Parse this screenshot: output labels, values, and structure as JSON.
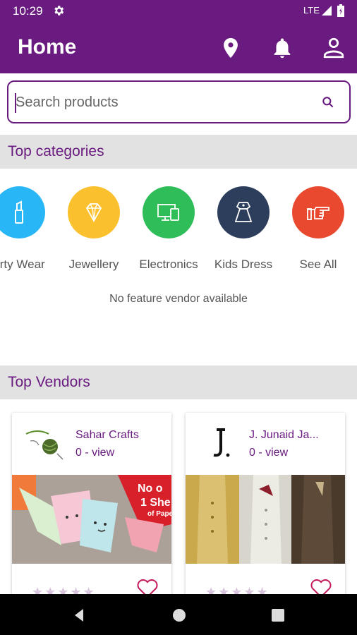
{
  "status_bar": {
    "time": "10:29",
    "network": "LTE"
  },
  "app_bar": {
    "title": "Home"
  },
  "search": {
    "placeholder": "Search products"
  },
  "sections": {
    "top_categories": "Top categories",
    "top_vendors": "Top Vendors"
  },
  "categories": [
    {
      "label": "arty Wear",
      "icon": "lipstick-icon",
      "color": "#29b6f6"
    },
    {
      "label": "Jewellery",
      "icon": "diamond-icon",
      "color": "#fbc02d"
    },
    {
      "label": "Electronics",
      "icon": "devices-icon",
      "color": "#2ebd59"
    },
    {
      "label": "Kids Dress",
      "icon": "kids-dress-icon",
      "color": "#2d3e5c"
    },
    {
      "label": "See All",
      "icon": "pointing-hand-icon",
      "color": "#e8492f"
    }
  ],
  "feature_vendor_message": "No feature vendor available",
  "vendors": [
    {
      "name": "Sahar Crafts",
      "views": "0 - view",
      "rating": 0,
      "banner_text": [
        "No o",
        "1 She",
        "of Pape"
      ]
    },
    {
      "name": "J. Junaid Ja...",
      "views": "0 - view",
      "rating": 0
    }
  ],
  "colors": {
    "primary": "#6a1b80",
    "header_bg": "#e2e2e2"
  }
}
